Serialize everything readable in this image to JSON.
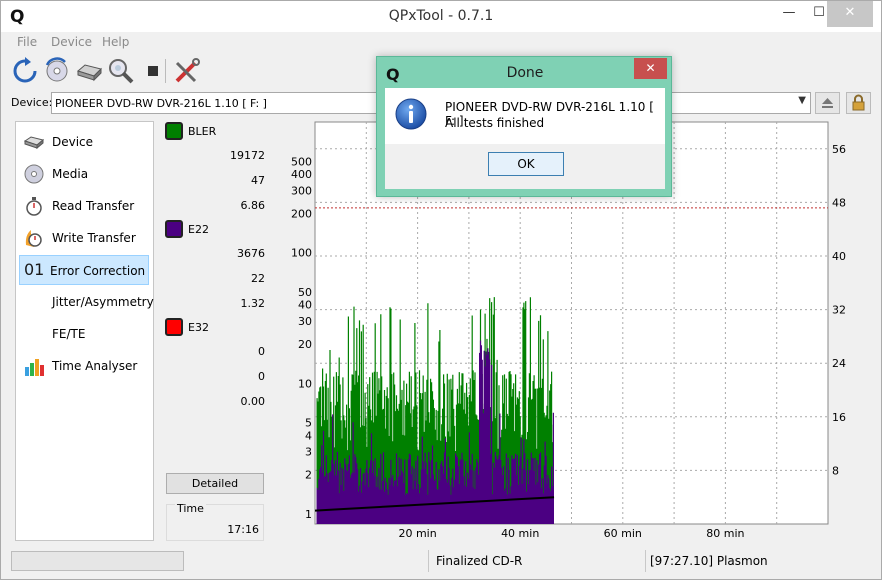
{
  "window": {
    "title": "QPxTool - 0.7.1",
    "app_icon": "Q",
    "minimize_glyph": "—",
    "maximize_glyph": "☐",
    "close_glyph": "✕"
  },
  "menu": {
    "items": [
      "File",
      "Device",
      "Help"
    ]
  },
  "toolbar": {
    "icons": [
      "refresh-icon",
      "reload-disc-icon",
      "drive-icon",
      "scan-disc-icon",
      "stop-icon",
      "tools-icon"
    ]
  },
  "device": {
    "label": "Device:",
    "value": "PIONEER  DVD-RW  DVR-216L 1.10 [ F: ]",
    "arrow": "▼"
  },
  "nav": {
    "items": [
      {
        "label": "Device",
        "icon": "drive-icon"
      },
      {
        "label": "Media",
        "icon": "disc-icon"
      },
      {
        "label": "Read Transfer",
        "icon": "stopwatch-icon"
      },
      {
        "label": "Write Transfer",
        "icon": "burning-stopwatch-icon"
      },
      {
        "label": "Error Correction",
        "icon": "error-correction-icon",
        "badge": "01",
        "active": true
      },
      {
        "label": "Jitter/Asymmetry",
        "icon": ""
      },
      {
        "label": "FE/TE",
        "icon": ""
      },
      {
        "label": "Time Analyser",
        "icon": "bar-chart-icon"
      }
    ]
  },
  "stats": {
    "groups": [
      {
        "name": "BLER",
        "color": "#008000",
        "values": [
          "19172",
          "47",
          "6.86"
        ]
      },
      {
        "name": "E22",
        "color": "#4b0082",
        "values": [
          "3676",
          "22",
          "1.32"
        ]
      },
      {
        "name": "E32",
        "color": "#ff0000",
        "values": [
          "0",
          "0",
          "0.00"
        ]
      }
    ],
    "detailed_label": "Detailed",
    "time_label": "Time",
    "time_value": "17:16"
  },
  "chart_data": {
    "type": "area",
    "title": "",
    "xlabel": "",
    "ylabel": "",
    "x_ticks": [
      "20 min",
      "40 min",
      "60 min",
      "80 min"
    ],
    "x_range_min": [
      0,
      100
    ],
    "y_left_scale": "log",
    "y_left_ticks": [
      "1",
      "2",
      "3",
      "4",
      "5",
      "10",
      "20",
      "30",
      "40",
      "50",
      "100",
      "200",
      "300",
      "400",
      "500"
    ],
    "y_left_range": [
      1,
      1000
    ],
    "y_right_ticks": [
      "8",
      "16",
      "24",
      "32",
      "40",
      "48",
      "56"
    ],
    "y_right_range": [
      0,
      60
    ],
    "limit_line": 220,
    "grid": true,
    "series": [
      {
        "name": "BLER",
        "color": "#008000",
        "x_end_min": 46.6,
        "typical": 6,
        "max": 47
      },
      {
        "name": "E22",
        "color": "#4b0082",
        "x_end_min": 46.6,
        "typical": 2,
        "max": 22
      },
      {
        "name": "E32",
        "color": "#ff0000",
        "x_end_min": 46.6,
        "typical": 0,
        "max": 0
      },
      {
        "name": "Speed",
        "color": "#000000",
        "x": [
          0,
          46.6
        ],
        "y": [
          2,
          4
        ]
      }
    ]
  },
  "status": {
    "media": "Finalized CD-R",
    "disc_info": "[97:27.10] Plasmon"
  },
  "dialog": {
    "title": "Done",
    "icon": "Q",
    "close_glyph": "✕",
    "message_line1": "PIONEER  DVD-RW  DVR-216L 1.10 [ F: ]:",
    "message_line2": "All tests finished",
    "ok_label": "OK"
  }
}
